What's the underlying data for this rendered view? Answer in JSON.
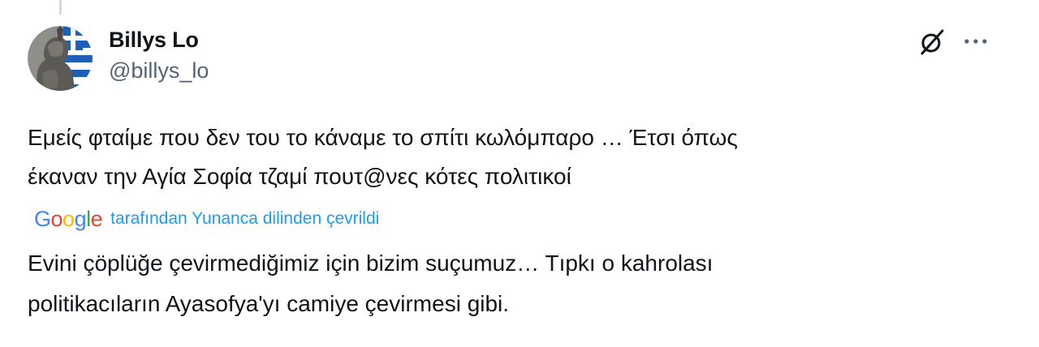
{
  "tweet": {
    "author": {
      "display_name": "Billys Lo",
      "handle": "@billys_lo"
    },
    "icons": {
      "grok": "grok-icon",
      "more": "more-icon"
    },
    "original_text": "Εμείς φταίμε που δεν του το κάναμε το σπίτι κωλόμπαρο … Έτσι όπως\nέκαναν την Αγία Σοφία τζαμί πουτ@νες κότες πολιτικοί",
    "translation": {
      "logo_text": "Google",
      "logo_letters": [
        "G",
        "o",
        "o",
        "g",
        "l",
        "e"
      ],
      "logo_colors": [
        "#4285F4",
        "#EA4335",
        "#FBBC05",
        "#4285F4",
        "#34A853",
        "#EA4335"
      ],
      "label": "tarafından Yunanca dilinden çevrildi",
      "text": "Evini çöplüğe çevirmediğimiz için bizim suçumuz… Tıpkı o kahrolası\npolitikacıların Ayasofya'yı camiye çevirmesi gibi."
    }
  },
  "colors": {
    "text": "#0f1419",
    "secondary": "#536471",
    "link": "#1d9bf0",
    "thread_line": "#cfd9de"
  }
}
